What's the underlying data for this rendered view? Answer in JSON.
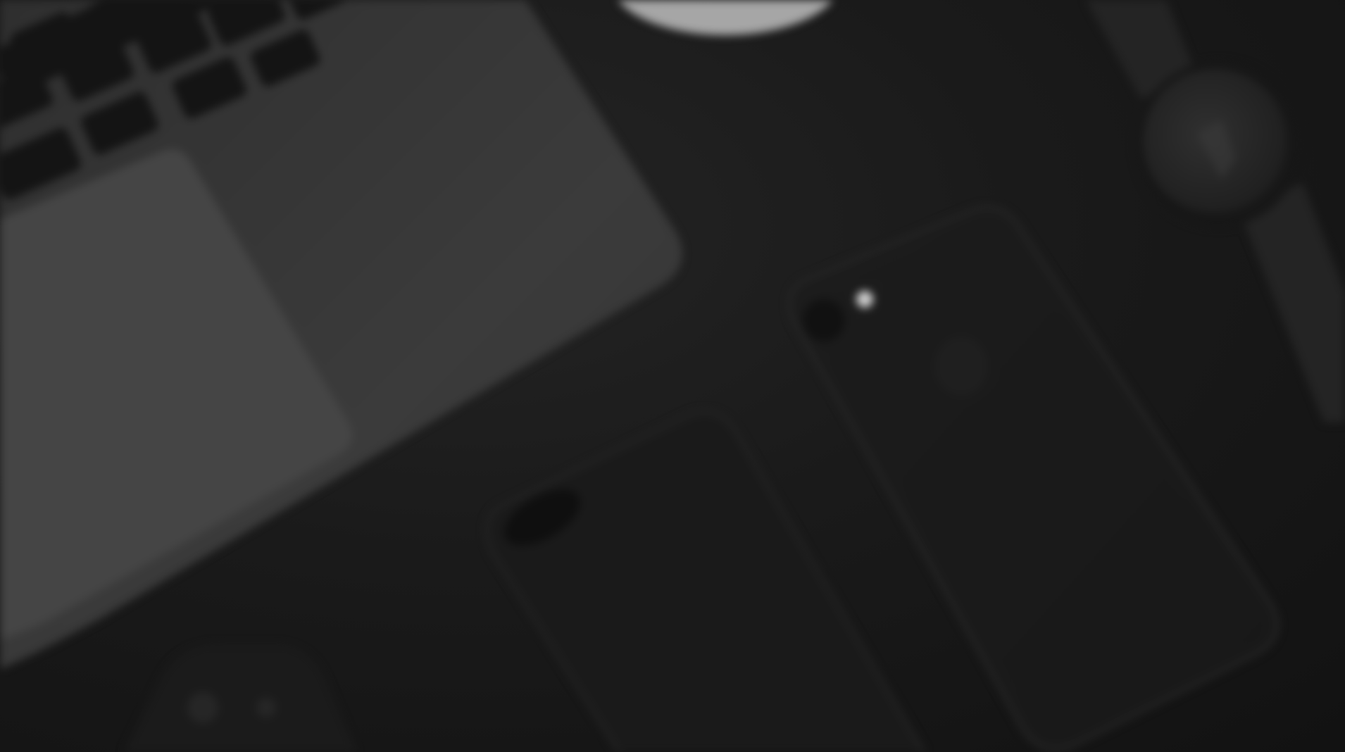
{
  "scene": {
    "palette": {
      "background": "#161616",
      "laptop_body": "#3a3a3a",
      "trackpad": "#444444",
      "keys": "#151515",
      "phone_front": "#1b1b1b",
      "phone_back": "#1a1a1a",
      "mouse": "#a8a8a8",
      "watch_strap": "#252525",
      "watch_face": "#2a2a2a"
    },
    "objects": [
      {
        "name": "laptop",
        "icon": "laptop-icon"
      },
      {
        "name": "mouse",
        "icon": "mouse-icon"
      },
      {
        "name": "watch",
        "icon": "watch-icon"
      },
      {
        "name": "phone-back",
        "icon": "phone-icon"
      },
      {
        "name": "phone-front",
        "icon": "phone-icon"
      },
      {
        "name": "phone-corner",
        "icon": "phone-icon"
      }
    ]
  }
}
